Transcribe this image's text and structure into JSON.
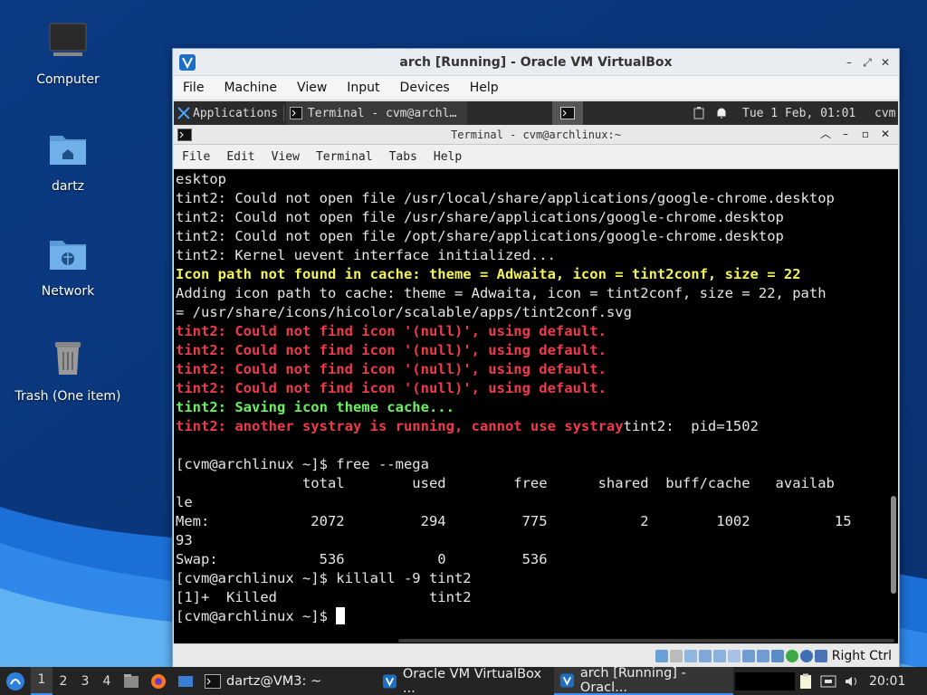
{
  "desktop": {
    "icons": [
      {
        "label": "Computer"
      },
      {
        "label": "dartz"
      },
      {
        "label": "Network"
      },
      {
        "label": "Trash (One item)"
      }
    ]
  },
  "vbox": {
    "title": "arch [Running] - Oracle VM VirtualBox",
    "menu": [
      "File",
      "Machine",
      "View",
      "Input",
      "Devices",
      "Help"
    ],
    "host_key": "Right Ctrl"
  },
  "guest_panel": {
    "applications": "Applications",
    "task": "Terminal - cvm@archl…",
    "datetime": "Tue  1 Feb, 01:01",
    "user": "cvm"
  },
  "terminal": {
    "title": "Terminal - cvm@archlinux:~",
    "menu": [
      "File",
      "Edit",
      "View",
      "Terminal",
      "Tabs",
      "Help"
    ],
    "lines": [
      {
        "t": "esktop",
        "s": "normal"
      },
      {
        "t": "tint2: Could not open file /usr/local/share/applications/google-chrome.desktop",
        "s": "normal"
      },
      {
        "t": "tint2: Could not open file /usr/share/applications/google-chrome.desktop",
        "s": "normal"
      },
      {
        "t": "tint2: Could not open file /opt/share/applications/google-chrome.desktop",
        "s": "normal"
      },
      {
        "t": "tint2: Kernel uevent interface initialized...",
        "s": "normal"
      },
      {
        "t": "Icon path not found in cache: theme = Adwaita, icon = tint2conf, size = 22",
        "s": "bold-yellow"
      },
      {
        "t": "Adding icon path to cache: theme = Adwaita, icon = tint2conf, size = 22, path",
        "s": "normal"
      },
      {
        "t": "= /usr/share/icons/hicolor/scalable/apps/tint2conf.svg",
        "s": "normal"
      },
      {
        "t": "tint2: Could not find icon '(null)', using default.",
        "s": "red"
      },
      {
        "t": "tint2: Could not find icon '(null)', using default.",
        "s": "red"
      },
      {
        "t": "tint2: Could not find icon '(null)', using default.",
        "s": "red"
      },
      {
        "t": "tint2: Could not find icon '(null)', using default.",
        "s": "red"
      },
      {
        "t": "tint2: Saving icon theme cache...",
        "s": "green"
      },
      {
        "t": "tint2: another systray is running, cannot use systray",
        "s": "red",
        "tail": "tint2:  pid=1502"
      },
      {
        "t": "",
        "s": "normal"
      },
      {
        "t": "[cvm@archlinux ~]$ free --mega",
        "s": "normal"
      },
      {
        "t": "               total        used        free      shared  buff/cache   availab",
        "s": "normal"
      },
      {
        "t": "le",
        "s": "normal"
      },
      {
        "t": "Mem:            2072         294         775           2        1002          15",
        "s": "normal"
      },
      {
        "t": "93",
        "s": "normal"
      },
      {
        "t": "Swap:            536           0         536",
        "s": "normal"
      },
      {
        "t": "[cvm@archlinux ~]$ killall -9 tint2",
        "s": "normal"
      },
      {
        "t": "[1]+  Killed                  tint2",
        "s": "normal"
      },
      {
        "t": "[cvm@archlinux ~]$ ",
        "s": "prompt"
      }
    ]
  },
  "taskbar": {
    "workspaces": [
      "1",
      "2",
      "3",
      "4"
    ],
    "active_workspace": "1",
    "apps": [
      {
        "label": "dartz@VM3: ~"
      },
      {
        "label": "Oracle VM VirtualBox ..."
      },
      {
        "label": "arch [Running] - Oracl..."
      }
    ],
    "clock": "20:01"
  },
  "colors": {
    "accent": "#3c8ff0",
    "term_red": "#ef3a4a",
    "term_yellow": "#f2f25a",
    "term_green": "#6af25e"
  }
}
